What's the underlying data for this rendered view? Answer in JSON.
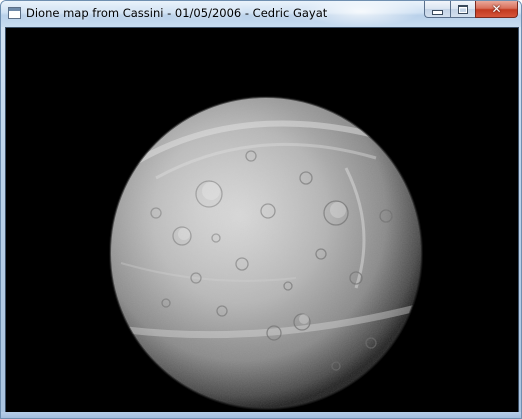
{
  "window": {
    "title": "Dione map from Cassini - 01/05/2006 - Cedric Gayat",
    "icon": "application-window-icon",
    "caption_buttons": {
      "minimize_glyph": "minimize-icon",
      "maximize_glyph": "maximize-icon",
      "close_glyph": "close-icon",
      "close_label": "✕"
    }
  },
  "viewport": {
    "background": "#000000",
    "subject": "Dione (moon of Saturn)"
  },
  "colors": {
    "titlebar": "#c8dcf0",
    "close_button": "#c2391f",
    "frame_border": "#6f8fb0"
  }
}
